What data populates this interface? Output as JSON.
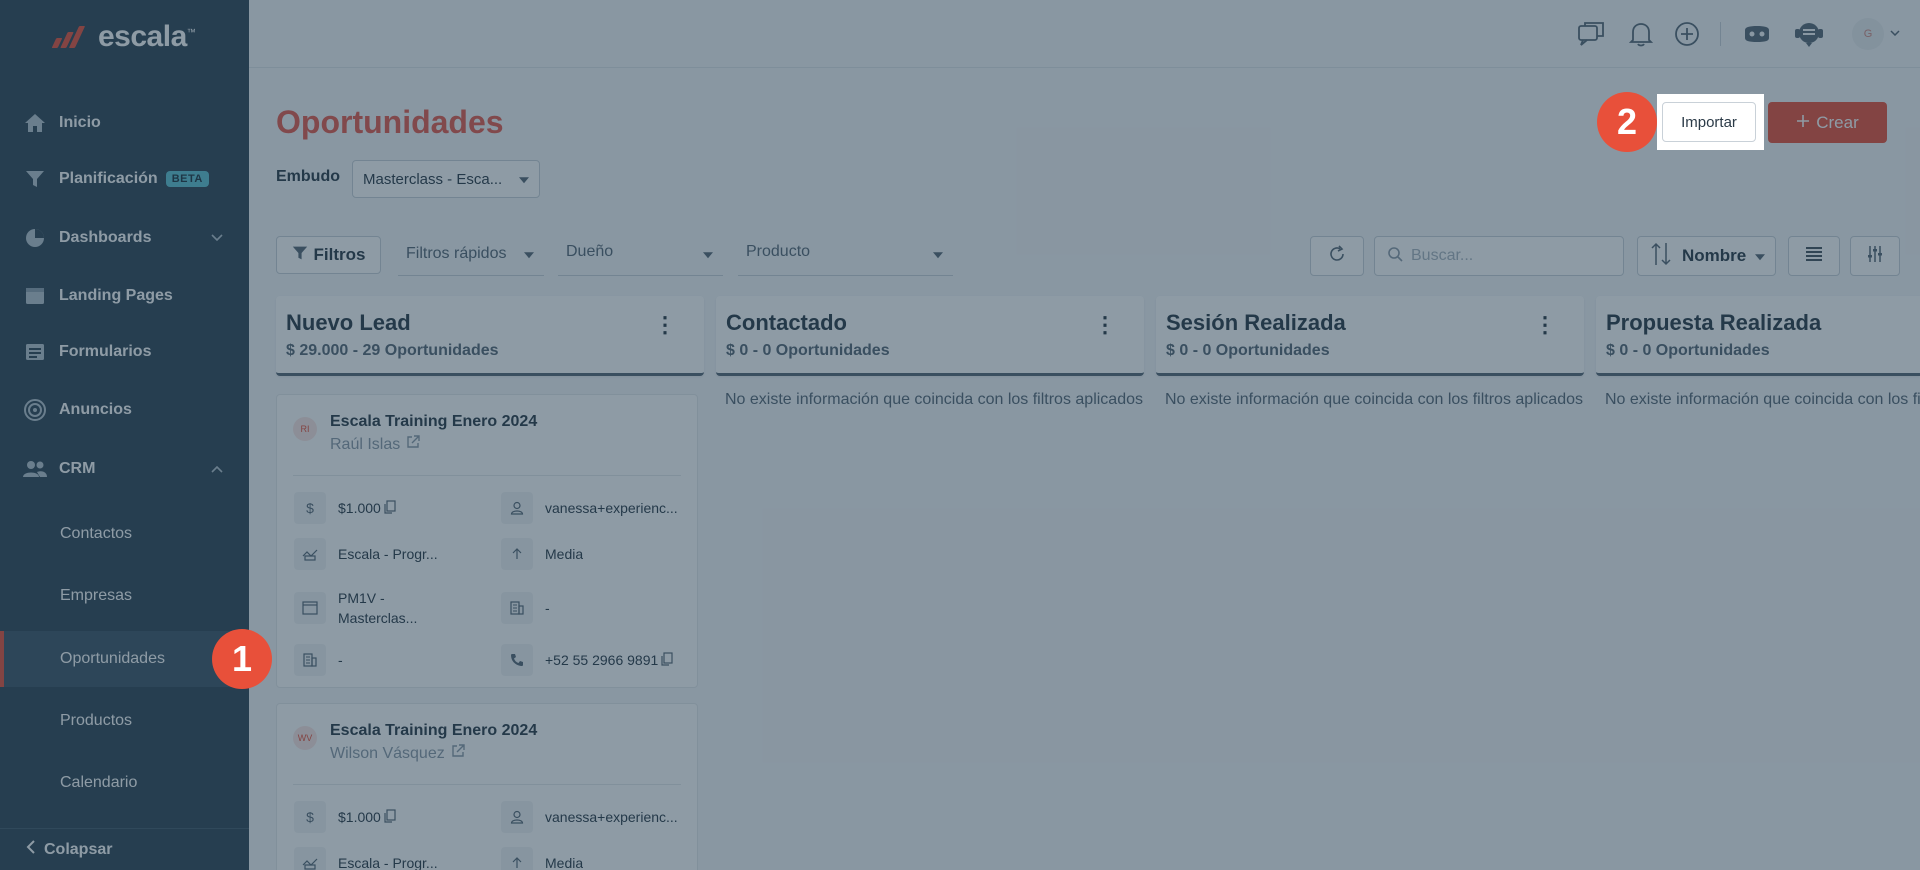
{
  "brand": {
    "name": "escala"
  },
  "colors": {
    "accent": "#e8503a",
    "sidebar": "#2e4555",
    "title": "#e45a4c"
  },
  "sidebar": {
    "items": [
      {
        "label": "Inicio",
        "icon": "home-icon"
      },
      {
        "label": "Planificación",
        "badge": "BETA",
        "icon": "funnel-icon"
      },
      {
        "label": "Dashboards",
        "icon": "pie-chart-icon",
        "chevron": "down"
      },
      {
        "label": "Landing Pages",
        "icon": "browser-icon"
      },
      {
        "label": "Formularios",
        "icon": "form-icon"
      },
      {
        "label": "Anuncios",
        "icon": "target-icon"
      },
      {
        "label": "CRM",
        "icon": "users-icon",
        "chevron": "up"
      }
    ],
    "crm_sub": [
      "Contactos",
      "Empresas",
      "Oportunidades",
      "Productos",
      "Calendario"
    ],
    "active": "Oportunidades",
    "collapse_label": "Colapsar"
  },
  "topbar": {
    "icons": [
      "chat-icon",
      "bell-icon",
      "plus-circle-icon",
      "gamepad-icon",
      "support-icon"
    ],
    "avatar_initial": "G"
  },
  "header": {
    "title": "Oportunidades",
    "embudo_label": "Embudo",
    "embudo_value": "Masterclass - Esca...",
    "import_label": "Importar",
    "create_label": "Crear"
  },
  "filters": {
    "filtros_label": "Filtros",
    "quick_label": "Filtros rápidos",
    "owner_label": "Dueño",
    "product_label": "Producto",
    "search_placeholder": "Buscar...",
    "sort_label": "Nombre"
  },
  "columns": [
    {
      "title": "Nuevo Lead",
      "summary": "$ 29.000 - 29 Oportunidades"
    },
    {
      "title": "Contactado",
      "summary": "$ 0 - 0 Oportunidades"
    },
    {
      "title": "Sesión Realizada",
      "summary": "$ 0 - 0 Oportunidades"
    },
    {
      "title": "Propuesta Realizada",
      "summary": "$ 0 - 0 Oportunidades"
    }
  ],
  "empty_message": "No existe información que coincida con los filtros aplicados",
  "cards": [
    {
      "initials": "RI",
      "title": "Escala Training Enero 2024",
      "person": "Raúl Islas",
      "amount": "$1.000",
      "email": "vanessa+experienc...",
      "product": "Escala - Progr...",
      "priority": "Media",
      "funnel": "PM1V - Masterclas...",
      "company": "-",
      "company2": "-",
      "phone": "+52 55 2966 9891"
    },
    {
      "initials": "WV",
      "title": "Escala Training Enero 2024",
      "person": "Wilson Vásquez",
      "amount": "$1.000",
      "email": "vanessa+experienc...",
      "product": "Escala - Progr...",
      "priority": "Media"
    }
  ],
  "steps": [
    "1",
    "2"
  ]
}
